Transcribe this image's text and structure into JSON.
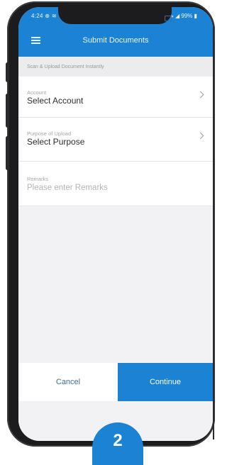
{
  "status_bar": {
    "time": "4:24 ⊕ ≋",
    "right": "⁎ ◢ 99% ▮"
  },
  "app_bar": {
    "title": "Submit Documents",
    "menu_icon": "hamburger-menu-icon"
  },
  "section_hint": "Scan & Upload Document Instantly",
  "fields": [
    {
      "label": "Account",
      "value": "Select Account"
    },
    {
      "label": "Purpose of Upload",
      "value": "Select Purpose"
    },
    {
      "label": "Remarks",
      "placeholder": "Please enter Remarks"
    }
  ],
  "footer": {
    "cancel_label": "Cancel",
    "continue_label": "Continue"
  },
  "step_badge": "2",
  "colors": {
    "primary": "#1b82d4",
    "background": "#f2f2f4",
    "cancel_text": "#3d6f95"
  }
}
